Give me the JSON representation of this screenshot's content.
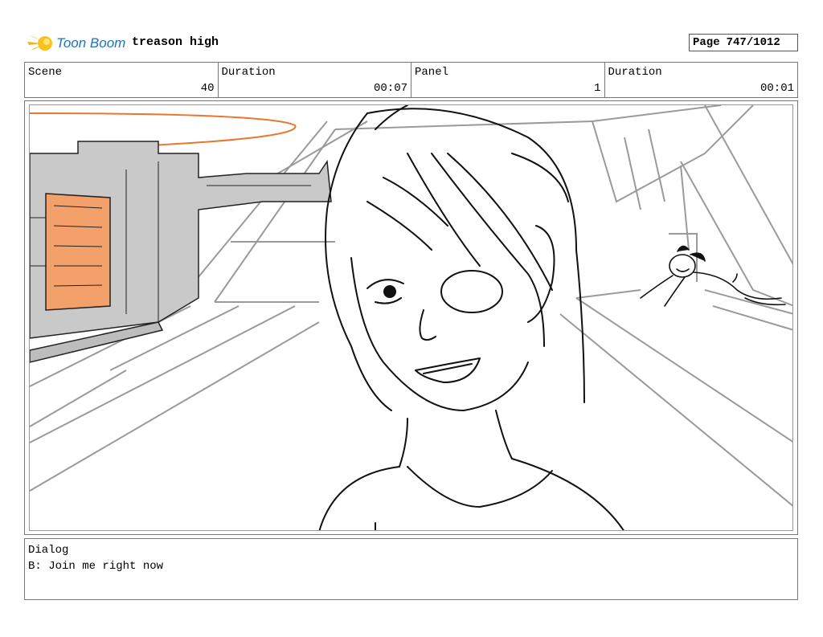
{
  "header": {
    "logo_text": "Toon Boom",
    "project_title": "treason high",
    "page_label": "Page",
    "page_value": "747/1012"
  },
  "info": {
    "scene_label": "Scene",
    "scene_value": "40",
    "duration_label": "Duration",
    "duration_value": "00:07",
    "panel_label": "Panel",
    "panel_value": "1",
    "panel_duration_label": "Duration",
    "panel_duration_value": "00:01"
  },
  "dialog": {
    "label": "Dialog",
    "text": "B: Join me right now"
  },
  "colors": {
    "logo_blue": "#1e72b8",
    "logo_yellow": "#f2b705",
    "accent_orange": "#f4a06a",
    "orbit_orange": "#e8772e",
    "machine_gray": "#c9c9c9"
  }
}
